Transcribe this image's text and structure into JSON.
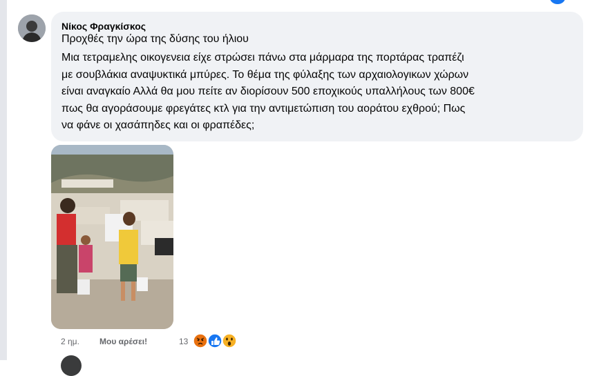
{
  "comment": {
    "author": "Νίκος Φραγκίσκος",
    "first_line": "Προχθές την ώρα της δύσης του ήλιου",
    "body_lines": [
      "Μια τετραμελης οικογενεια είχε στρώσει πάνω στα μάρμαρα της πορτάρας τραπέζι",
      "με σουβλάκια αναψυκτικά μπύρες. Το θέμα της φύλαξης των αρχαιολογικων χώρων",
      "είναι αναγκαίο Αλλά θα μου πείτε αν διορίσουν 500 εποχικούς υπαλλήλους των 800€",
      "πως θα αγοράσουμε φρεγάτες κτλ για την αντιμετώπιση του αοράτου εχθρού; Πως",
      "να φάνε οι χασάπηδες και οι φραπέδες;"
    ],
    "time": "2 ημ.",
    "like_label": "Μου αρέσει!",
    "reaction_count": "13",
    "reactions": [
      "angry-reaction-icon",
      "like-reaction-icon",
      "wow-reaction-icon"
    ]
  },
  "colors": {
    "bubble": "#f0f2f5",
    "secondary_text": "#65676b",
    "like_blue": "#1877f2",
    "angry": "#e9710f",
    "wow": "#f7b125"
  }
}
